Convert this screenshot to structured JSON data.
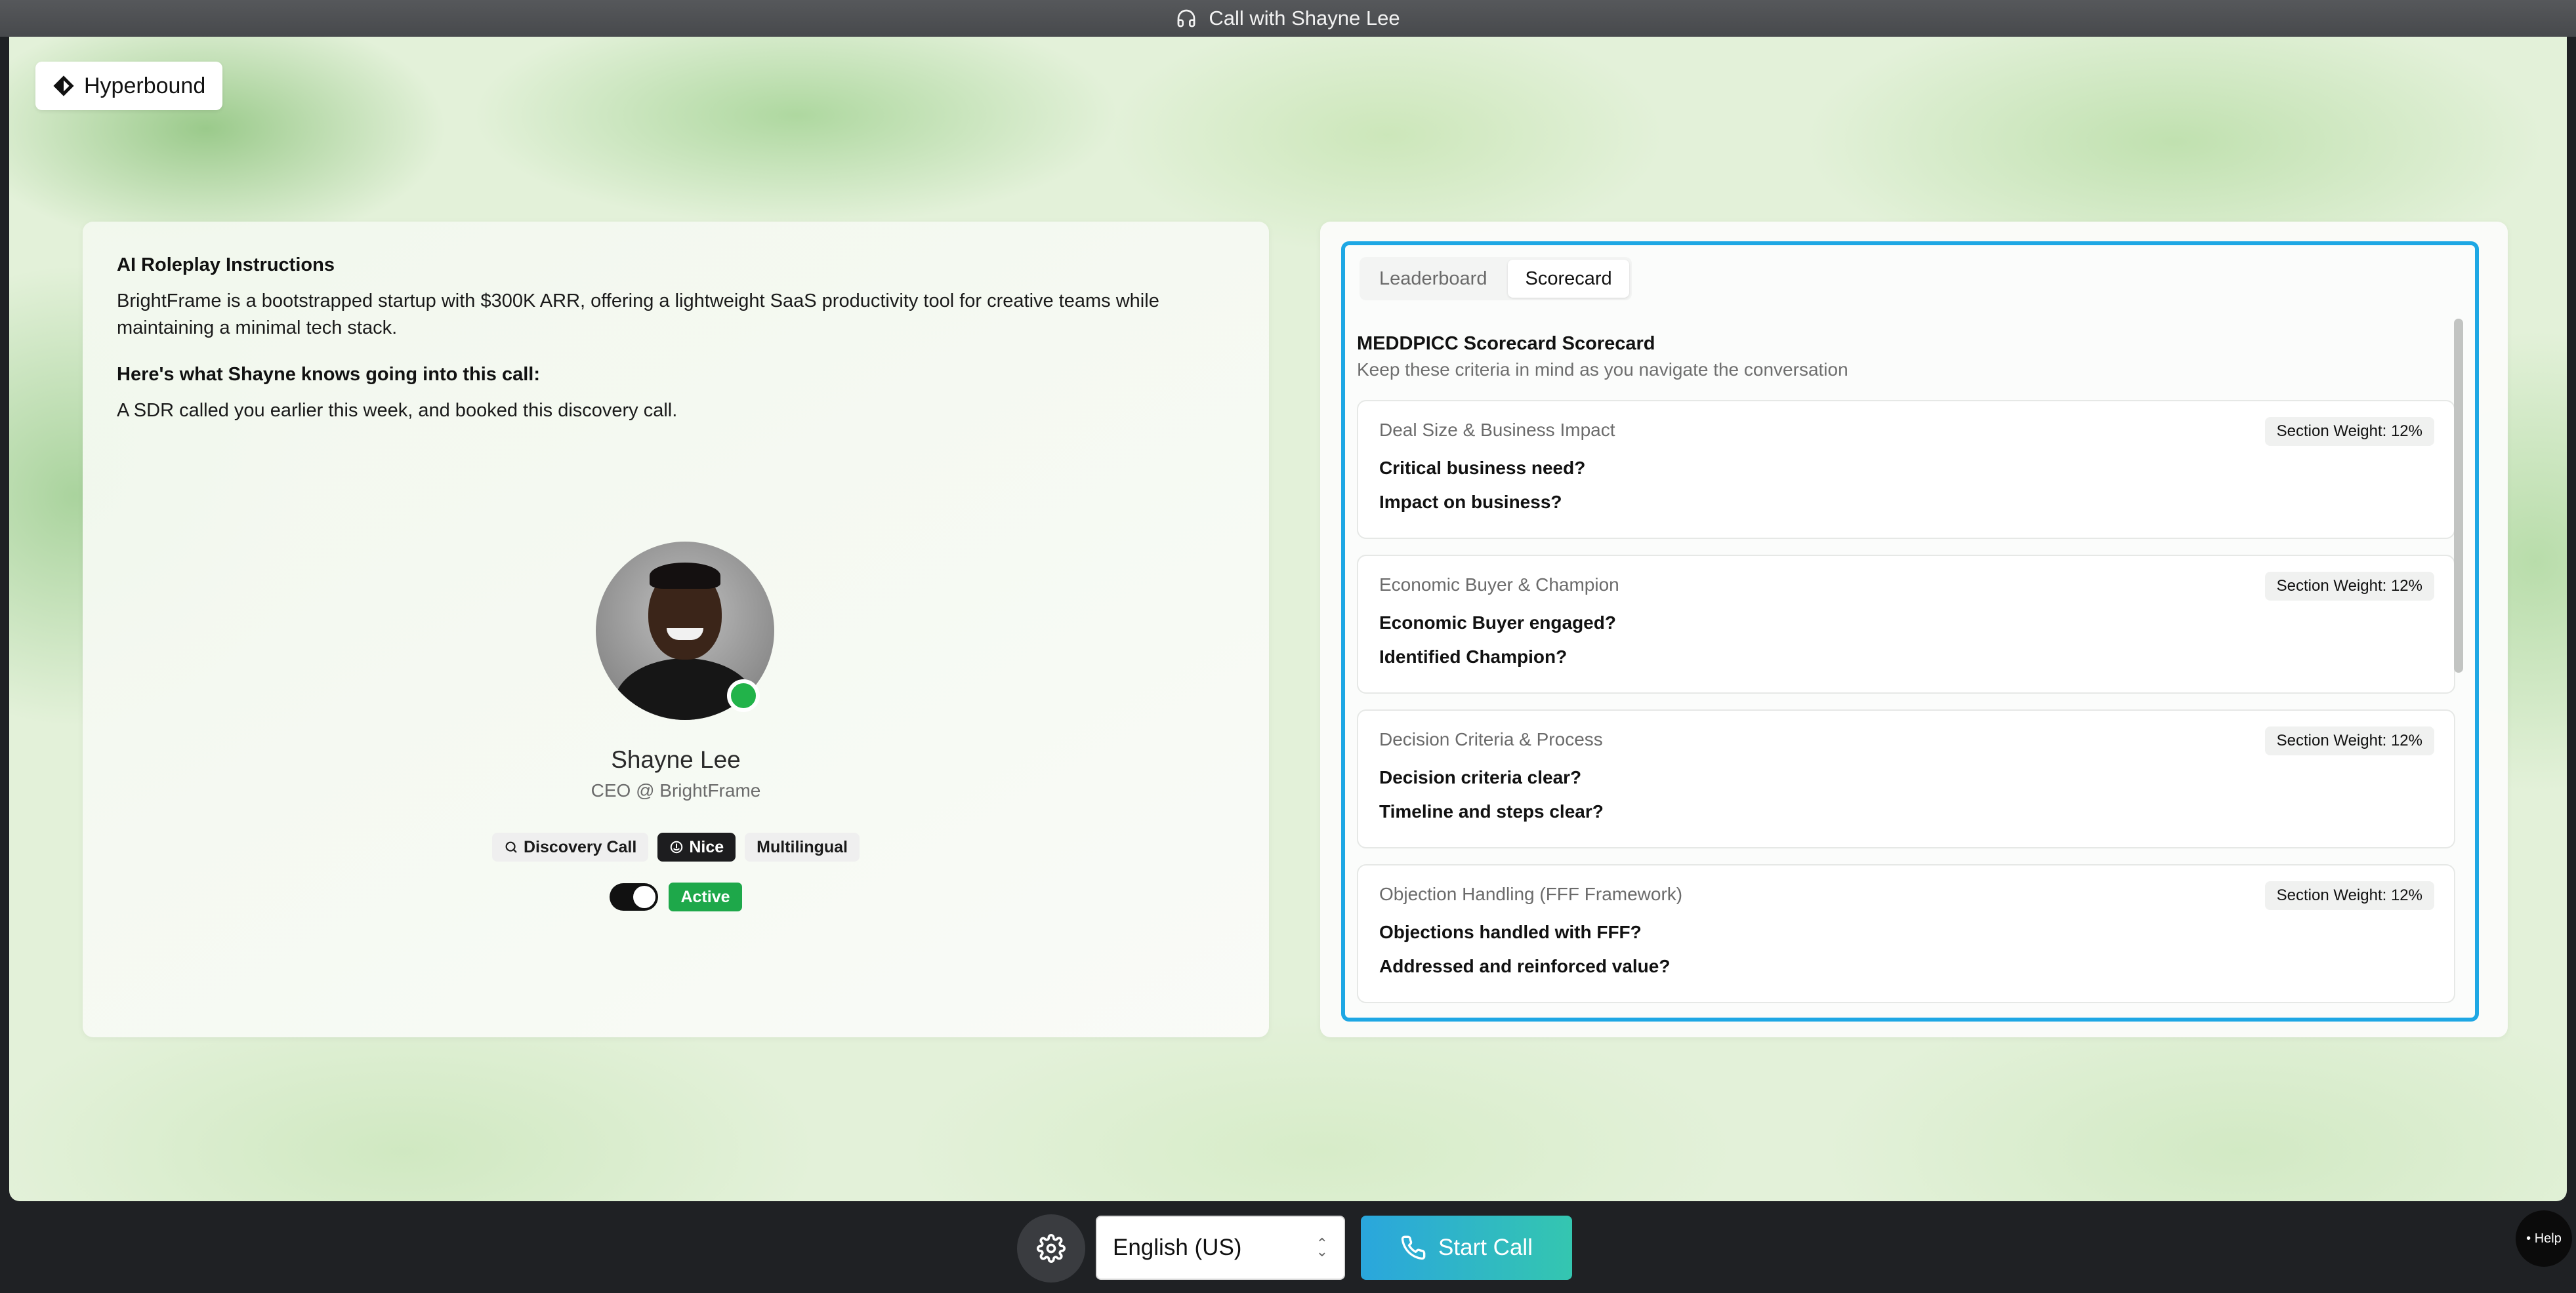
{
  "window": {
    "title": "Call with Shayne Lee"
  },
  "brand": {
    "name": "Hyperbound"
  },
  "instructions": {
    "heading": "AI Roleplay Instructions",
    "description": "BrightFrame is a bootstrapped startup with $300K ARR, offering a lightweight SaaS productivity tool for creative teams while maintaining a minimal tech stack.",
    "knows_heading": "Here's what Shayne knows going into this call:",
    "knows_text": "A SDR called you earlier this week, and booked this discovery call."
  },
  "persona": {
    "name": "Shayne Lee",
    "role": "CEO @ BrightFrame",
    "online": true,
    "tags": [
      "Discovery Call",
      "Nice",
      "Multilingual"
    ],
    "toggle_on": true,
    "status_label": "Active"
  },
  "tabs": [
    {
      "label": "Leaderboard",
      "selected": false
    },
    {
      "label": "Scorecard",
      "selected": true
    }
  ],
  "scorecard": {
    "title": "MEDDPICC Scorecard Scorecard",
    "subtitle": "Keep these criteria in mind as you navigate the conversation",
    "sections": [
      {
        "title": "Deal Size & Business Impact",
        "weight": "Section Weight: 12%",
        "questions": [
          "Critical business need?",
          "Impact on business?"
        ]
      },
      {
        "title": "Economic Buyer & Champion",
        "weight": "Section Weight: 12%",
        "questions": [
          "Economic Buyer engaged?",
          "Identified Champion?"
        ]
      },
      {
        "title": "Decision Criteria & Process",
        "weight": "Section Weight: 12%",
        "questions": [
          "Decision criteria clear?",
          "Timeline and steps clear?"
        ]
      },
      {
        "title": "Objection Handling (FFF Framework)",
        "weight": "Section Weight: 12%",
        "questions": [
          "Objections handled with FFF?",
          "Addressed and reinforced value?"
        ]
      }
    ]
  },
  "controls": {
    "language": "English (US)",
    "start_label": "Start Call",
    "help_label": "Help",
    "icons": [
      "headphones-icon",
      "gear-icon",
      "phone-icon",
      "search-icon",
      "smile-icon",
      "hyperbound-logo-icon"
    ]
  },
  "colors": {
    "accent": "#1ea7e4",
    "active_green": "#1ea84a",
    "start_gradient": [
      "#2aa6dd",
      "#34c6b0"
    ]
  }
}
